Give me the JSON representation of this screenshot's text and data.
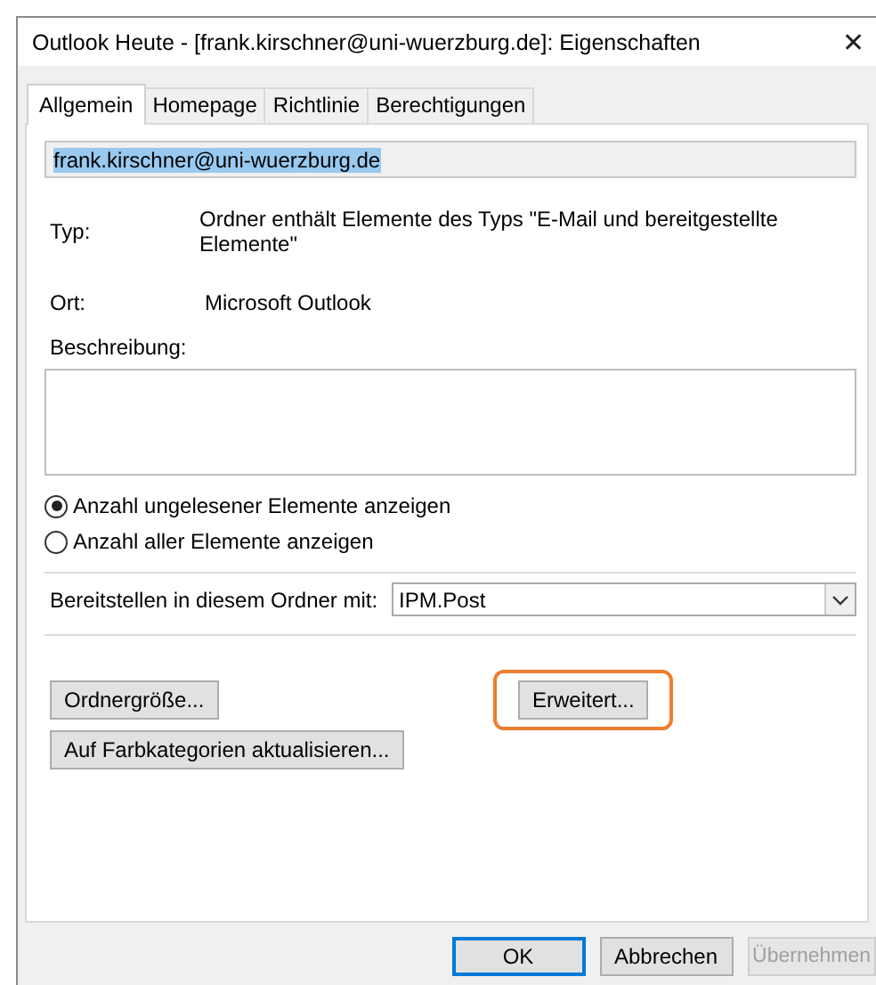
{
  "window": {
    "title": "Outlook Heute - [frank.kirschner@uni-wuerzburg.de]: Eigenschaften",
    "close": "✕"
  },
  "tabs": [
    {
      "label": "Allgemein",
      "selected": true
    },
    {
      "label": "Homepage",
      "selected": false
    },
    {
      "label": "Richtlinie",
      "selected": false
    },
    {
      "label": "Berechtigungen",
      "selected": false
    }
  ],
  "name_field": {
    "value": "frank.kirschner@uni-wuerzburg.de",
    "text_selected": true
  },
  "properties": [
    {
      "label": "Typ:",
      "value": "Ordner enthält Elemente des Typs \"E-Mail und bereitgestellte Elemente\""
    },
    {
      "label": "Ort:",
      "value": "Microsoft Outlook"
    }
  ],
  "description": {
    "label": "Beschreibung:"
  },
  "radios": [
    {
      "label": "Anzahl ungelesener Elemente anzeigen",
      "selected": true
    },
    {
      "label": "Anzahl aller Elemente anzeigen",
      "selected": false
    }
  ],
  "post_to": {
    "label": "Bereitstellen in diesem Ordner mit:",
    "value": "IPM.Post"
  },
  "buttons": [
    {
      "label": "Ordnergröße...",
      "highlighted": false
    },
    {
      "label": "Erweitert...",
      "highlighted": true
    },
    {
      "label": "Auf Farbkategorien aktualisieren...",
      "highlighted": false
    }
  ],
  "footer_buttons": [
    {
      "label": "OK",
      "default": true,
      "disabled": false
    },
    {
      "label": "Abbrechen",
      "default": false,
      "disabled": false
    },
    {
      "label": "Übernehmen",
      "default": false,
      "disabled": true
    }
  ]
}
